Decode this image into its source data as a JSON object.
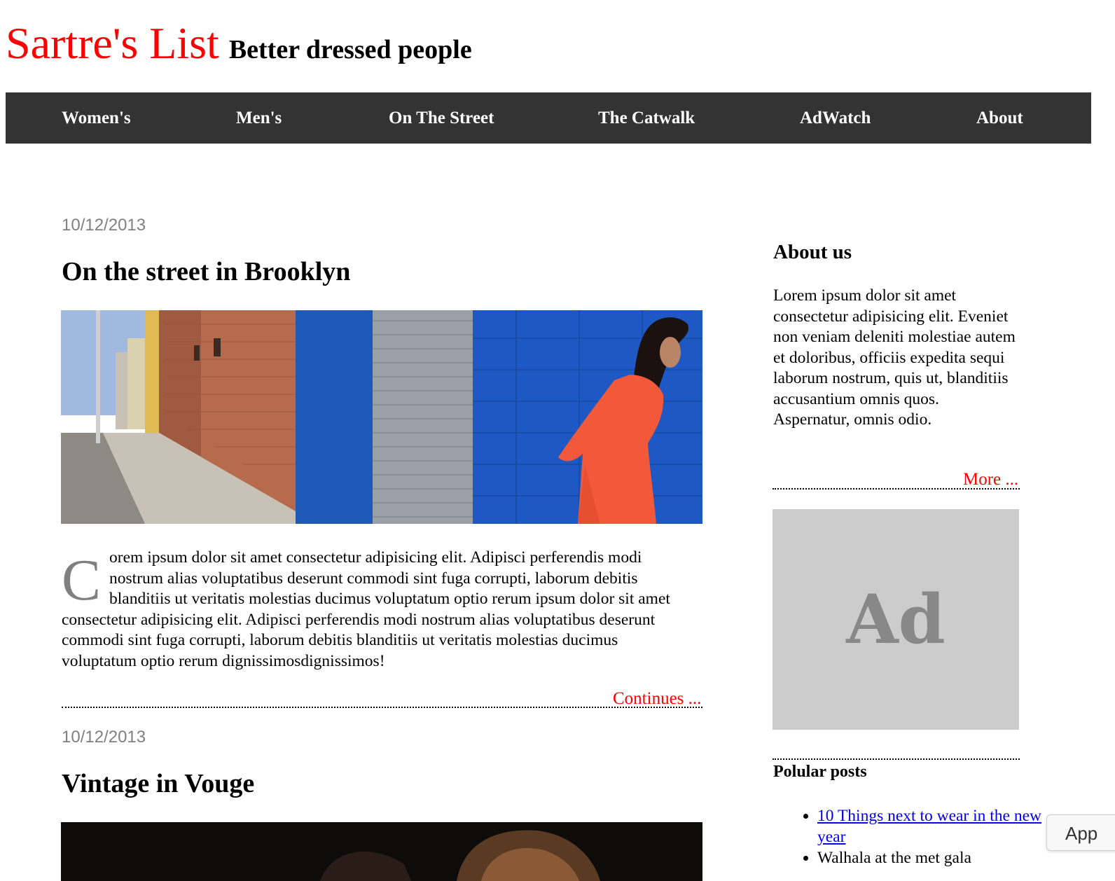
{
  "site": {
    "title": "Sartre's List",
    "tagline": "Better dressed people",
    "accent_color": "#ff0000",
    "nav_bg": "#333333"
  },
  "nav": {
    "items": [
      "Women's",
      "Men's",
      "On The Street",
      "The Catwalk",
      "AdWatch",
      "About"
    ]
  },
  "posts": [
    {
      "date": "10/12/2013",
      "title": "On the street in Brooklyn",
      "image": "street-photo-woman-red-dress-blue-wall",
      "dropcap": "C",
      "body": "orem ipsum dolor sit amet consectetur adipisicing elit. Adipisci perferendis modi nostrum alias voluptatibus deserunt commodi sint fuga corrupti, laborum debitis blanditiis ut veritatis molestias ducimus voluptatum optio rerum ipsum dolor sit amet consectetur adipisicing elit. Adipisci perferendis modi nostrum alias voluptatibus deserunt commodi sint fuga corrupti, laborum debitis blanditiis ut veritatis molestias ducimus voluptatum optio rerum dignissimosdignissimos!",
      "continue_label": "Continues ..."
    },
    {
      "date": "10/12/2013",
      "title": "Vintage in Vouge",
      "image": "dark-portrait-photo"
    }
  ],
  "sidebar": {
    "about": {
      "heading": "About us",
      "text": "Lorem ipsum dolor sit amet consectetur adipisicing elit. Eveniet non veniam deleniti molestiae autem et doloribus, officiis expedita sequi laborum nostrum, quis ut, blanditiis accusantium omnis quos. Aspernatur, omnis odio.",
      "more_label": "More ..."
    },
    "ad": {
      "label": "Ad"
    },
    "popular": {
      "heading": "Polular posts",
      "items": [
        "10 Things next to wear in the new year",
        "Walhala at the met gala"
      ]
    }
  },
  "overlay": {
    "chip_label": "App"
  }
}
